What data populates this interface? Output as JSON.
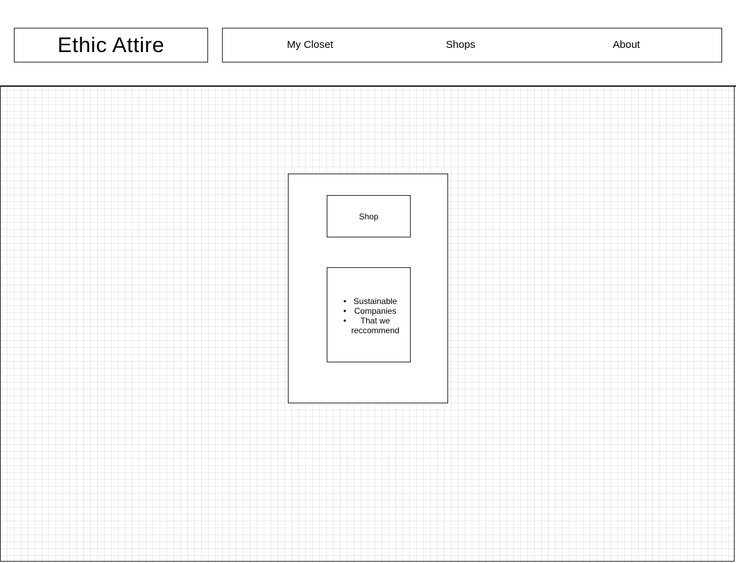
{
  "header": {
    "brand": "Ethic Attire",
    "nav": [
      {
        "label": "My Closet"
      },
      {
        "label": "Shops"
      },
      {
        "label": "About"
      }
    ]
  },
  "card": {
    "shop_button": "Shop",
    "bullets": [
      "Sustainable",
      "Companies",
      "That we"
    ],
    "continuation": "reccommend"
  }
}
